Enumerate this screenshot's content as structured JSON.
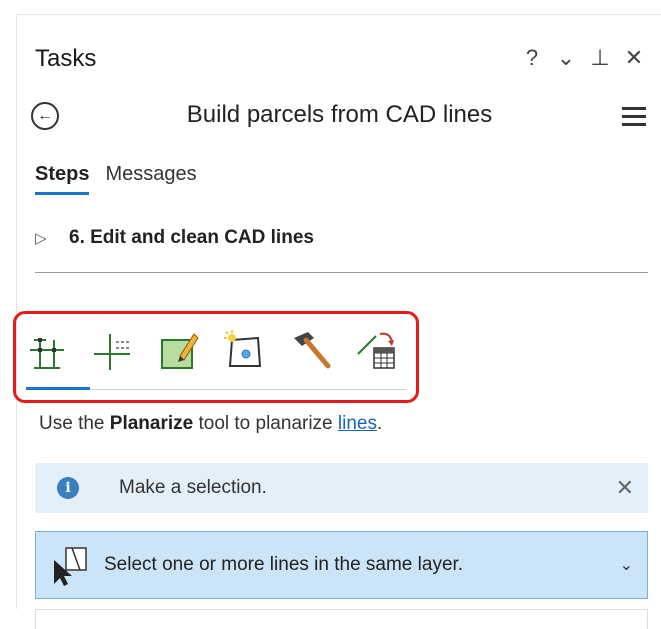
{
  "pane": {
    "title": "Tasks",
    "controls": {
      "help": "?",
      "options": "⌄",
      "pin": "⊥",
      "close": "✕"
    },
    "task_name": "Build parcels from CAD lines"
  },
  "tabs": [
    {
      "label": "Steps",
      "active": true
    },
    {
      "label": "Messages",
      "active": false
    }
  ],
  "step": {
    "number_label": "6.  Edit and clean CAD lines"
  },
  "tools": [
    {
      "icon": "planarize-icon",
      "selected": true
    },
    {
      "icon": "extend-trim-icon",
      "selected": false
    },
    {
      "icon": "edit-polygon-icon",
      "selected": false
    },
    {
      "icon": "build-parcel-icon",
      "selected": false
    },
    {
      "icon": "hammer-icon",
      "selected": false
    },
    {
      "icon": "attribute-table-icon",
      "selected": false
    }
  ],
  "instruction": {
    "prefix": "Use the ",
    "tool": "Planarize",
    "middle": " tool to planarize ",
    "link": "lines",
    "suffix": "."
  },
  "info": {
    "message": "Make a selection.",
    "close": "✕"
  },
  "selection": {
    "message": "Select one or more lines in the same layer.",
    "chevron": "⌄"
  },
  "colors": {
    "accent": "#1976c9",
    "highlight_box": "#e41b1b",
    "info_bg": "#e3eff9",
    "select_bg": "#cce4f7"
  }
}
